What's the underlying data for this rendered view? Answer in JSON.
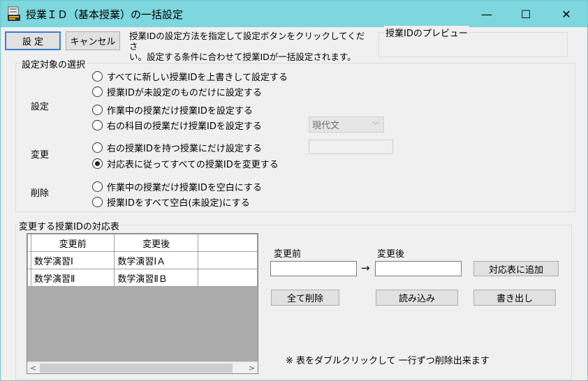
{
  "window": {
    "title": "授業ＩＤ（基本授業）の一括設定",
    "minimize_glyph": "—",
    "maximize_glyph": "☐",
    "close_glyph": "✕"
  },
  "toolbar": {
    "set_label": "設 定",
    "cancel_label": "キャンセル",
    "instruction_line1": "授業IDの設定方法を指定して設定ボタンをクリックしてくださ",
    "instruction_line2": "い。設定する条件に合わせて授業IDが一括設定されます。"
  },
  "preview": {
    "title": "授業IDのプレビュー"
  },
  "target_group": {
    "title": "設定対象の選択",
    "section_set": "設定",
    "section_change": "変更",
    "section_delete": "削除",
    "options": [
      {
        "label": "すべてに新しい授業IDを上書きして設定する",
        "checked": false
      },
      {
        "label": "授業IDが未設定のものだけに設定する",
        "checked": false
      },
      {
        "label": "作業中の授業だけ授業IDを設定する",
        "checked": false
      },
      {
        "label": "右の科目の授業だけ授業IDを設定する",
        "checked": false
      },
      {
        "label": "右の授業IDを持つ授業にだけ設定する",
        "checked": false
      },
      {
        "label": "対応表に従ってすべての授業IDを変更する",
        "checked": true
      },
      {
        "label": "作業中の授業だけ授業IDを空白にする",
        "checked": false
      },
      {
        "label": "授業IDをすべて空白(未設定)にする",
        "checked": false
      }
    ],
    "subject_combo": {
      "value": "現代文",
      "arrow": "﹀"
    }
  },
  "mapping_group": {
    "title": "変更する授業IDの対応表",
    "columns": [
      "変更前",
      "変更後"
    ],
    "rows": [
      [
        "数学演習Ⅰ",
        "数学演習ⅠＡ"
      ],
      [
        "数学演習Ⅱ",
        "数学演習ⅡＢ"
      ]
    ],
    "before_label": "変更前",
    "after_label": "変更後",
    "arrow": "→",
    "add_button": "対応表に追加",
    "delete_all_button": "全て削除",
    "load_button": "読み込み",
    "export_button": "書き出し",
    "note": "※ 表をダブルクリックして 一行ずつ削除出来ます",
    "scroll_left": "<",
    "scroll_right": ">"
  }
}
